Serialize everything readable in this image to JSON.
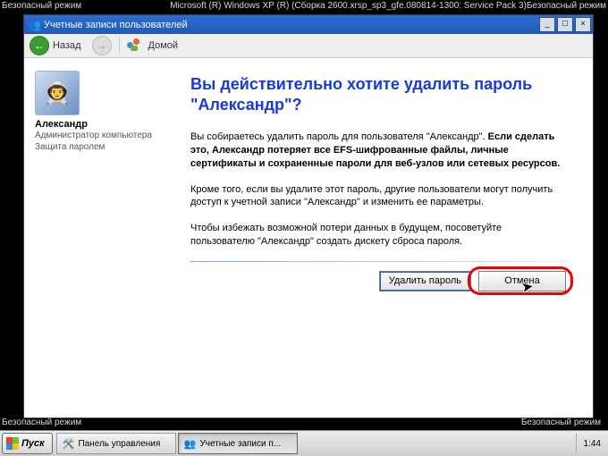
{
  "safe_mode": {
    "top_left": "Безопасный режим",
    "top_right": "Microsoft (R) Windows XP (R) (Сборка 2600.xrsp_sp3_gfe.080814-1300: Service Pack 3)Безопасный режим",
    "bottom_left": "Безопасный режим",
    "bottom_right": "Безопасный режим"
  },
  "window": {
    "title": "Учетные записи пользователей",
    "nav_back": "Назад",
    "nav_home": "Домой"
  },
  "user": {
    "name": "Александр",
    "role": "Администратор компьютера",
    "protection": "Защита паролем"
  },
  "main": {
    "heading": "Вы действительно хотите удалить пароль \"Александр\"?",
    "p1_plain": "Вы собираетесь удалить пароль для пользователя \"Александр\". ",
    "p1_bold": "Если сделать это, Александр потеряет все EFS-шифрованные файлы, личные сертификаты и сохраненные пароли для веб-узлов или сетевых ресурсов.",
    "p2": "Кроме того, если вы удалите этот пароль, другие пользователи могут получить доступ к учетной записи \"Александр\" и изменить ее параметры.",
    "p3": "Чтобы избежать возможной потери данных в будущем, посоветуйте пользователю \"Александр\" создать дискету сброса пароля.",
    "btn_delete": "Удалить пароль",
    "btn_cancel": "Отмена"
  },
  "taskbar": {
    "start": "Пуск",
    "task1": "Панель управления",
    "task2": "Учетные записи п...",
    "clock": "1:44"
  }
}
